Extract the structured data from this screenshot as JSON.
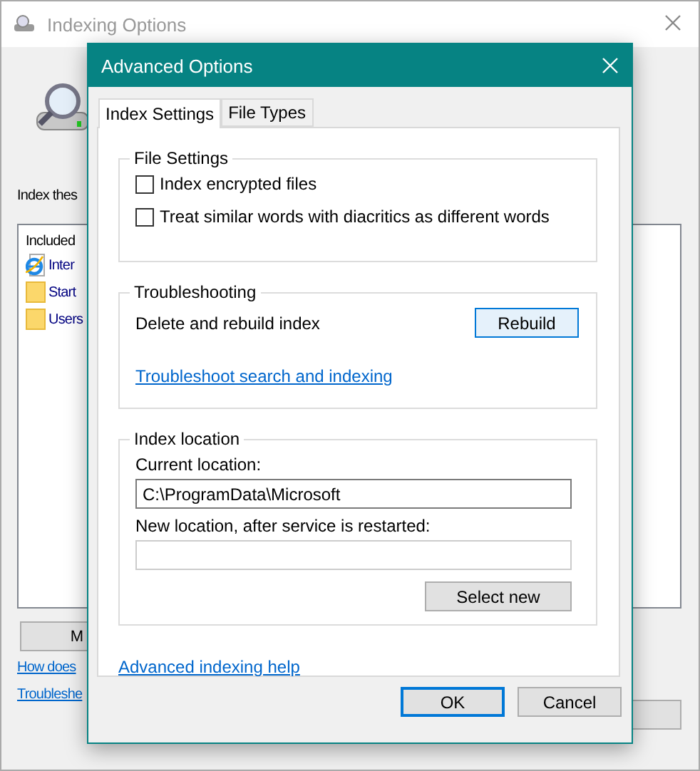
{
  "main_window": {
    "title": "Indexing Options",
    "intro": "Index thes",
    "list": {
      "header": "Included",
      "items": [
        {
          "label": "Inter",
          "kind": "web"
        },
        {
          "label": "Start",
          "kind": "folder"
        },
        {
          "label": "Users",
          "kind": "folder"
        }
      ]
    },
    "button": "M",
    "links": [
      "How does",
      "Troubleshe"
    ]
  },
  "dialog": {
    "title": "Advanced Options",
    "tabs": [
      {
        "label": "Index Settings",
        "selected": true
      },
      {
        "label": "File Types",
        "selected": false
      }
    ],
    "file_settings": {
      "title": "File Settings",
      "options": [
        {
          "label": "Index encrypted files",
          "checked": false
        },
        {
          "label": "Treat similar words with diacritics as different words",
          "checked": false
        }
      ]
    },
    "troubleshooting": {
      "title": "Troubleshooting",
      "text": "Delete and rebuild index",
      "button": "Rebuild",
      "link": "Troubleshoot search and indexing"
    },
    "index_location": {
      "title": "Index location",
      "current_label": "Current location:",
      "current_value": "C:\\ProgramData\\Microsoft",
      "new_label": "New location, after service is restarted:",
      "button": "Select new"
    },
    "help_link": "Advanced indexing help",
    "buttons": [
      {
        "label": "OK",
        "default": true
      },
      {
        "label": "Cancel",
        "default": false
      }
    ]
  }
}
